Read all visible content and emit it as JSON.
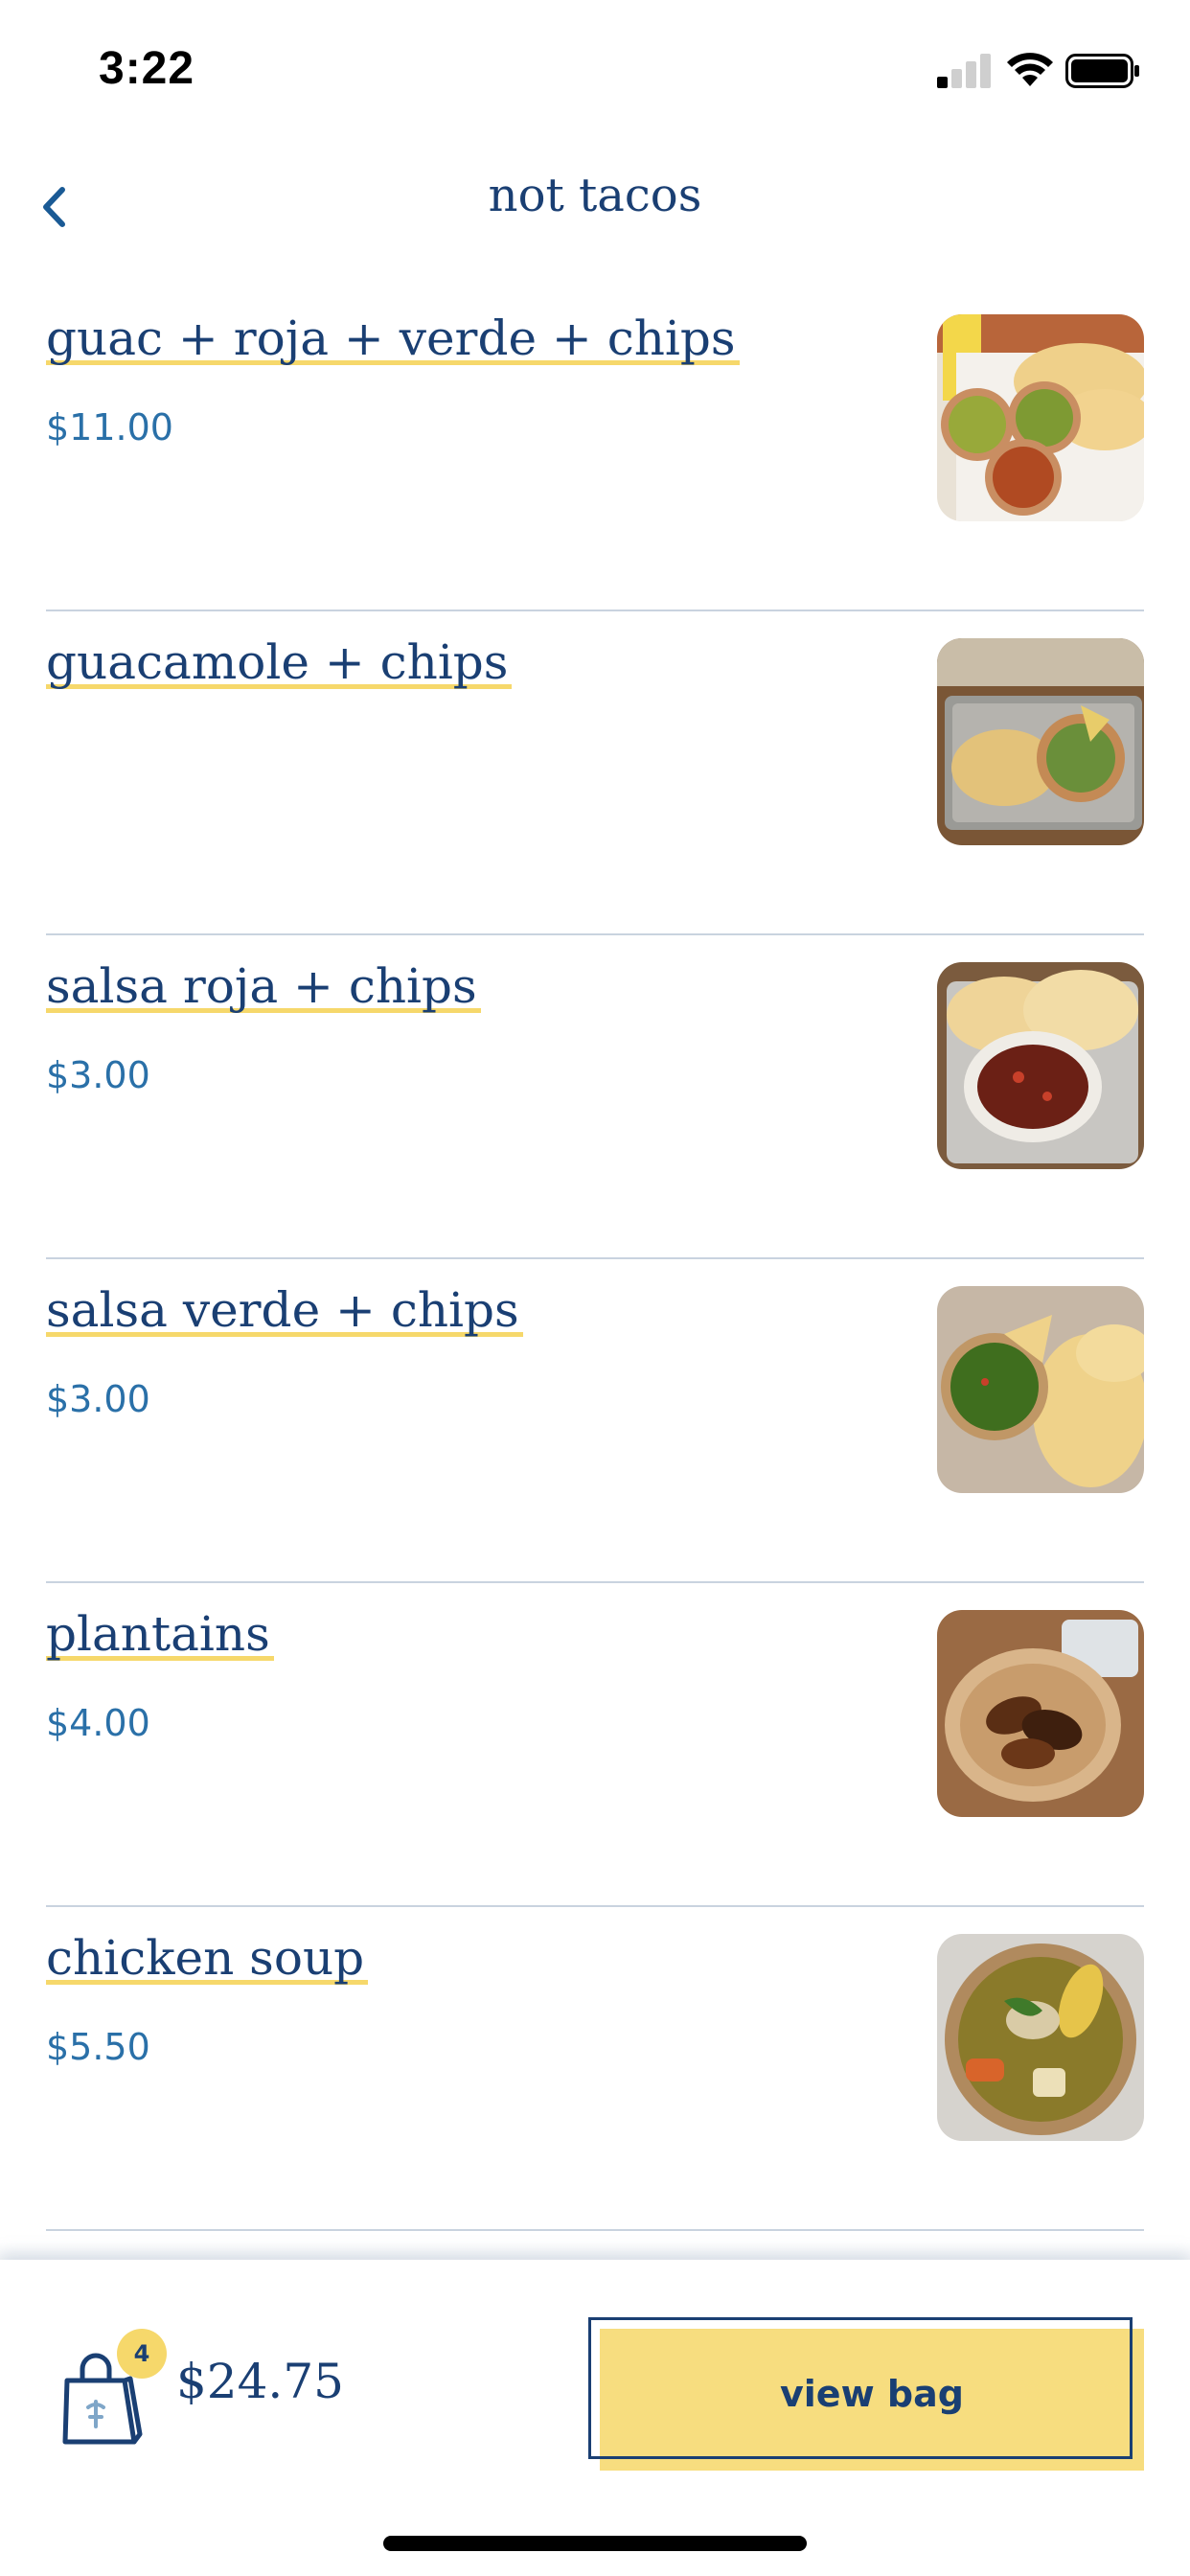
{
  "status_bar": {
    "time": "3:22"
  },
  "nav": {
    "title": "not tacos"
  },
  "menu_items": [
    {
      "name": "guac + roja + verde + chips",
      "price": "$11.00",
      "photo": "guac-roja-verde-chips-photo"
    },
    {
      "name": "guacamole + chips",
      "price": "",
      "photo": "guacamole-chips-photo"
    },
    {
      "name": "salsa roja + chips",
      "price": "$3.00",
      "photo": "salsa-roja-chips-photo"
    },
    {
      "name": "salsa verde + chips",
      "price": "$3.00",
      "photo": "salsa-verde-chips-photo"
    },
    {
      "name": "plantains",
      "price": "$4.00",
      "photo": "plantains-photo"
    },
    {
      "name": "chicken soup",
      "price": "$5.50",
      "photo": "chicken-soup-photo"
    }
  ],
  "bag": {
    "count": "4",
    "total": "$24.75",
    "button_label": "view bag"
  },
  "colors": {
    "navy": "#1a3f73",
    "price_blue": "#2a70a8",
    "accent_yellow": "#f6d86b",
    "divider": "#c9d3df"
  }
}
